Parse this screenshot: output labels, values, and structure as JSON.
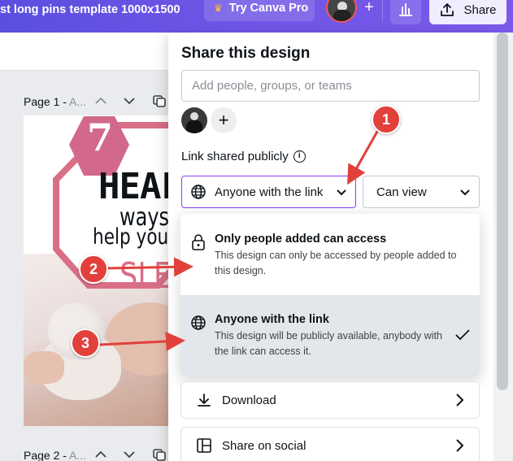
{
  "header": {
    "doc_title": "st long pins template 1000x1500",
    "try_pro_label": "Try Canva Pro",
    "share_label": "Share"
  },
  "pages": [
    {
      "label": "Page 1 - ",
      "suffix": "A..."
    },
    {
      "label": "Page 2 - ",
      "suffix": "A..."
    }
  ],
  "design": {
    "number": "7",
    "line1": "HEALT",
    "line2": "ways",
    "line3": "help your",
    "line4": "SLE"
  },
  "share_panel": {
    "title": "Share this design",
    "people_placeholder": "Add people, groups, or teams",
    "link_label": "Link shared publicly",
    "access_value": "Anyone with the link",
    "permission_value": "Can view",
    "options": [
      {
        "title": "Only people added can access",
        "desc": "This design can only be accessed by people added to this design.",
        "selected": false
      },
      {
        "title": "Anyone with the link",
        "desc": "This design will be publicly available, anybody with the link can access it.",
        "selected": true
      }
    ],
    "actions": [
      {
        "label": "Download",
        "icon": "download-icon"
      },
      {
        "label": "Share on social",
        "icon": "social-icon"
      }
    ]
  },
  "annotations": [
    "1",
    "2",
    "3"
  ],
  "colors": {
    "accent": "#8b3dff",
    "header": "#6a53e4",
    "callout": "#e2403b",
    "design_pink": "#d96f86"
  }
}
